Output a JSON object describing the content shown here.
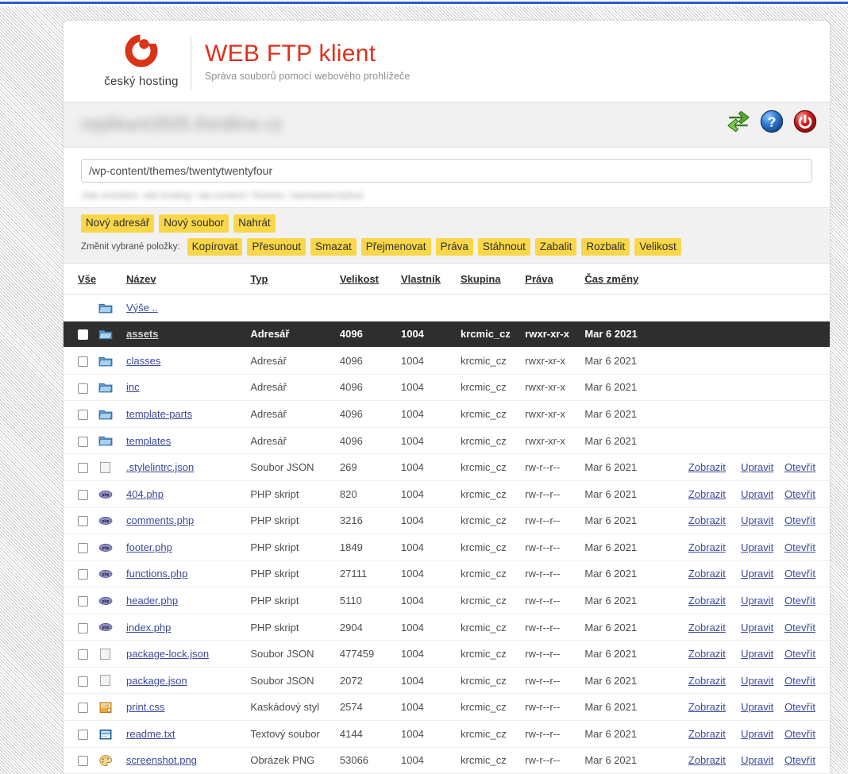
{
  "brand": {
    "name": "český hosting",
    "logo_icon": "ceskyhosting-c-logo-icon",
    "accent_color": "#d93318"
  },
  "header": {
    "title": "WEB FTP klient",
    "subtitle": "Správa souborů pomocí webového prohlížeče"
  },
  "account_bar": {
    "domain_text": "replikant3505.thirdline.cz",
    "actions": [
      {
        "name": "refresh-icon",
        "title": "Obnovit"
      },
      {
        "name": "help-icon",
        "title": "Nápověda"
      },
      {
        "name": "logout-icon",
        "title": "Odhlásit"
      }
    ]
  },
  "location": {
    "path_value": "/wp-content/themes/twentytwentyfour",
    "path_placeholder": "/",
    "breadcrumb_text": "Jste umístěni: váš hosting / wp-content / themes / twentytwentyfour"
  },
  "toolbar": {
    "create_buttons": [
      "Nový adresář",
      "Nový soubor",
      "Nahrát"
    ],
    "bulk_label": "Změnit vybrané položky:",
    "bulk_buttons": [
      "Kopírovat",
      "Přesunout",
      "Smazat",
      "Přejmenovat",
      "Práva",
      "Stáhnout",
      "Zabalit",
      "Rozbalit",
      "Velikost"
    ],
    "button_color": "#fad749"
  },
  "table": {
    "headers": [
      "Vše",
      "Název",
      "Typ",
      "Velikost",
      "Vlastník",
      "Skupina",
      "Práva",
      "Čas změny"
    ],
    "actions": {
      "view": "Zobrazit",
      "edit": "Upravit",
      "open": "Otevřít"
    },
    "parent_row": {
      "name": "Výše ..",
      "icon": "folder-icon"
    },
    "rows": [
      {
        "name": "assets",
        "icon": "folder-icon",
        "type": "Adresář",
        "size": "4096",
        "owner": "1004",
        "group": "krcmic_cz",
        "perms": "rwxr-xr-x",
        "time": "Mar 6 2021",
        "selected": true,
        "has_actions": false
      },
      {
        "name": "classes",
        "icon": "folder-icon",
        "type": "Adresář",
        "size": "4096",
        "owner": "1004",
        "group": "krcmic_cz",
        "perms": "rwxr-xr-x",
        "time": "Mar 6 2021",
        "selected": false,
        "has_actions": false
      },
      {
        "name": "inc",
        "icon": "folder-icon",
        "type": "Adresář",
        "size": "4096",
        "owner": "1004",
        "group": "krcmic_cz",
        "perms": "rwxr-xr-x",
        "time": "Mar 6 2021",
        "selected": false,
        "has_actions": false
      },
      {
        "name": "template-parts",
        "icon": "folder-icon",
        "type": "Adresář",
        "size": "4096",
        "owner": "1004",
        "group": "krcmic_cz",
        "perms": "rwxr-xr-x",
        "time": "Mar 6 2021",
        "selected": false,
        "has_actions": false
      },
      {
        "name": "templates",
        "icon": "folder-icon",
        "type": "Adresář",
        "size": "4096",
        "owner": "1004",
        "group": "krcmic_cz",
        "perms": "rwxr-xr-x",
        "time": "Mar 6 2021",
        "selected": false,
        "has_actions": false
      },
      {
        "name": ".stylelintrc.json",
        "icon": "blank-file-icon",
        "type": "Soubor JSON",
        "size": "269",
        "owner": "1004",
        "group": "krcmic_cz",
        "perms": "rw-r--r--",
        "time": "Mar 6 2021",
        "selected": false,
        "has_actions": true
      },
      {
        "name": "404.php",
        "icon": "php-file-icon",
        "type": "PHP skript",
        "size": "820",
        "owner": "1004",
        "group": "krcmic_cz",
        "perms": "rw-r--r--",
        "time": "Mar 6 2021",
        "selected": false,
        "has_actions": true
      },
      {
        "name": "comments.php",
        "icon": "php-file-icon",
        "type": "PHP skript",
        "size": "3216",
        "owner": "1004",
        "group": "krcmic_cz",
        "perms": "rw-r--r--",
        "time": "Mar 6 2021",
        "selected": false,
        "has_actions": true
      },
      {
        "name": "footer.php",
        "icon": "php-file-icon",
        "type": "PHP skript",
        "size": "1849",
        "owner": "1004",
        "group": "krcmic_cz",
        "perms": "rw-r--r--",
        "time": "Mar 6 2021",
        "selected": false,
        "has_actions": true
      },
      {
        "name": "functions.php",
        "icon": "php-file-icon",
        "type": "PHP skript",
        "size": "27111",
        "owner": "1004",
        "group": "krcmic_cz",
        "perms": "rw-r--r--",
        "time": "Mar 6 2021",
        "selected": false,
        "has_actions": true
      },
      {
        "name": "header.php",
        "icon": "php-file-icon",
        "type": "PHP skript",
        "size": "5110",
        "owner": "1004",
        "group": "krcmic_cz",
        "perms": "rw-r--r--",
        "time": "Mar 6 2021",
        "selected": false,
        "has_actions": true
      },
      {
        "name": "index.php",
        "icon": "php-file-icon",
        "type": "PHP skript",
        "size": "2904",
        "owner": "1004",
        "group": "krcmic_cz",
        "perms": "rw-r--r--",
        "time": "Mar 6 2021",
        "selected": false,
        "has_actions": true
      },
      {
        "name": "package-lock.json",
        "icon": "blank-file-icon",
        "type": "Soubor JSON",
        "size": "477459",
        "owner": "1004",
        "group": "krcmic_cz",
        "perms": "rw-r--r--",
        "time": "Mar 6 2021",
        "selected": false,
        "has_actions": true
      },
      {
        "name": "package.json",
        "icon": "blank-file-icon",
        "type": "Soubor JSON",
        "size": "2072",
        "owner": "1004",
        "group": "krcmic_cz",
        "perms": "rw-r--r--",
        "time": "Mar 6 2021",
        "selected": false,
        "has_actions": true
      },
      {
        "name": "print.css",
        "icon": "css-file-icon",
        "type": "Kaskádový styl",
        "size": "2574",
        "owner": "1004",
        "group": "krcmic_cz",
        "perms": "rw-r--r--",
        "time": "Mar 6 2021",
        "selected": false,
        "has_actions": true
      },
      {
        "name": "readme.txt",
        "icon": "text-file-icon",
        "type": "Textový soubor",
        "size": "4144",
        "owner": "1004",
        "group": "krcmic_cz",
        "perms": "rw-r--r--",
        "time": "Mar 6 2021",
        "selected": false,
        "has_actions": true
      },
      {
        "name": "screenshot.png",
        "icon": "image-file-icon",
        "type": "Obrázek PNG",
        "size": "53066",
        "owner": "1004",
        "group": "krcmic_cz",
        "perms": "rw-r--r--",
        "time": "Mar 6 2021",
        "selected": false,
        "has_actions": true
      }
    ]
  }
}
